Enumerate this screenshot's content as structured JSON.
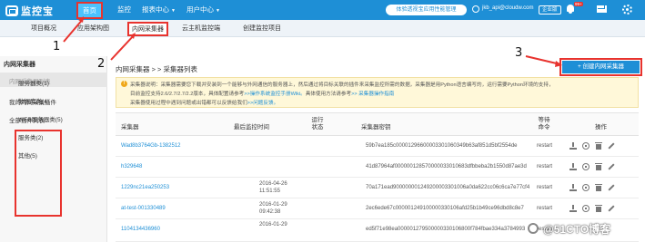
{
  "header": {
    "logo_text": "监控宝",
    "nav": [
      {
        "label": "首页",
        "caret": false
      },
      {
        "label": "监控",
        "caret": false
      },
      {
        "label": "报表中心",
        "caret": true
      },
      {
        "label": "用户中心",
        "caret": true
      }
    ],
    "cta": "体验透视宝应用性能管理",
    "user_email": "jkb_api@cloudw.com",
    "enterprise_badge": "企业版",
    "notification_count": "99+"
  },
  "subnav": {
    "tabs": [
      "项目概况",
      "应用架构图",
      "内网采集器",
      "云主机监控端",
      "创建监控项目"
    ]
  },
  "sidebar": {
    "title": "内网采集器",
    "items": [
      {
        "label": "内网采集器列表",
        "muted": true
      },
      {
        "label": "我的内网采集插件",
        "muted": false
      },
      {
        "label": "全部插件列表",
        "muted": false
      }
    ],
    "categories": [
      "服务器类(1)",
      "数据库类(4)",
      "WEB服务器类(5)",
      "服务类(2)",
      "其他(5)"
    ]
  },
  "main": {
    "breadcrumb": "内网采集器 > > 采集器列表",
    "create_button": "+ 创建内网采集器",
    "notice": {
      "icon": "!",
      "line1": "采集器说明：采集器需要您下载并安装到一个能够与外网通信的服务器上，然后通过将目标关联的插件来采集监控所需的数据，采集器是用Python语言编写的，运行需要Python环境的支持，",
      "line2_prefix": "目前监控支持2.6/2.7/2.7/2.2版本，具体配置请参考",
      "line2_link1": ">>操作系统监控手册Wiki。",
      "line2_mid": "具体使用方法请参考",
      "line2_link2": ">> 采集器操作指南",
      "line3_prefix": "采集器使用过程中遇到问题或出错都可以反馈给我们",
      "line3_link": ">>问题反馈。"
    },
    "table": {
      "headers": [
        "采集器",
        "最后监控时间",
        "运行状态",
        "采集器密钥",
        "等待命令",
        "操作"
      ],
      "rows": [
        {
          "name": "Wad8b3764Gb-1382512",
          "time": "",
          "key": "59b7ea185c00001296600003301060349b63af851d5bf2554de",
          "wait": "restart"
        },
        {
          "name": "h329648",
          "time": "",
          "key": "41d87964af000000128570000033010683dfbbeba2b1550d87ae3d",
          "wait": "restart"
        },
        {
          "name": "1229nc21ea250253",
          "time": "2016-04-26 11:51:55",
          "key": "70a171ead900000001249200003301006a0da622cc06c6ca7e77cf4",
          "wait": "restart"
        },
        {
          "name": "at-test-001330489",
          "time": "2016-01-29 09:42:38",
          "key": "2ec6ede67c000001249100000330106afd25b1b49ce96dbd8c8e7",
          "wait": "restart"
        },
        {
          "name": "1104134436960",
          "time": "2016-01-29",
          "key": "ed5f71e98ea000001279500000330106800f784fbae334a3784993",
          "wait": "restart"
        }
      ]
    }
  },
  "annotations": [
    "1",
    "2",
    "3"
  ],
  "watermark": "@51CTO博客",
  "colors": {
    "brand": "#1e8fd6",
    "highlight": "#e8332e"
  }
}
